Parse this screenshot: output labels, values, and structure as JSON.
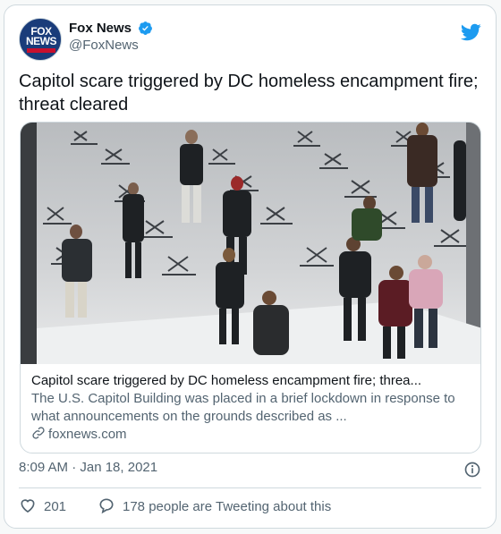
{
  "account": {
    "name": "Fox News",
    "handle": "@FoxNews",
    "avatar_text": [
      "FOX",
      "NEWS"
    ],
    "verified_color": "#1d9bf0"
  },
  "tweet": {
    "text": "Capitol scare triggered by DC homeless encampment fire; threat cleared"
  },
  "link_card": {
    "title": "Capitol scare triggered by DC homeless encampment fire; threa...",
    "description": "The U.S. Capitol Building was placed in a brief lockdown in response to what announcements on the grounds described as ...",
    "domain": "foxnews.com",
    "image_icon": "photo-of-people-walking-past-chairs"
  },
  "meta": {
    "timestamp": "8:09 AM · Jan 18, 2021"
  },
  "actions": {
    "likes": "201",
    "replies_text": "178 people are Tweeting about this"
  },
  "colors": {
    "twitter_blue": "#1d9bf0",
    "secondary_text": "#536471",
    "border": "#cfd9de"
  }
}
